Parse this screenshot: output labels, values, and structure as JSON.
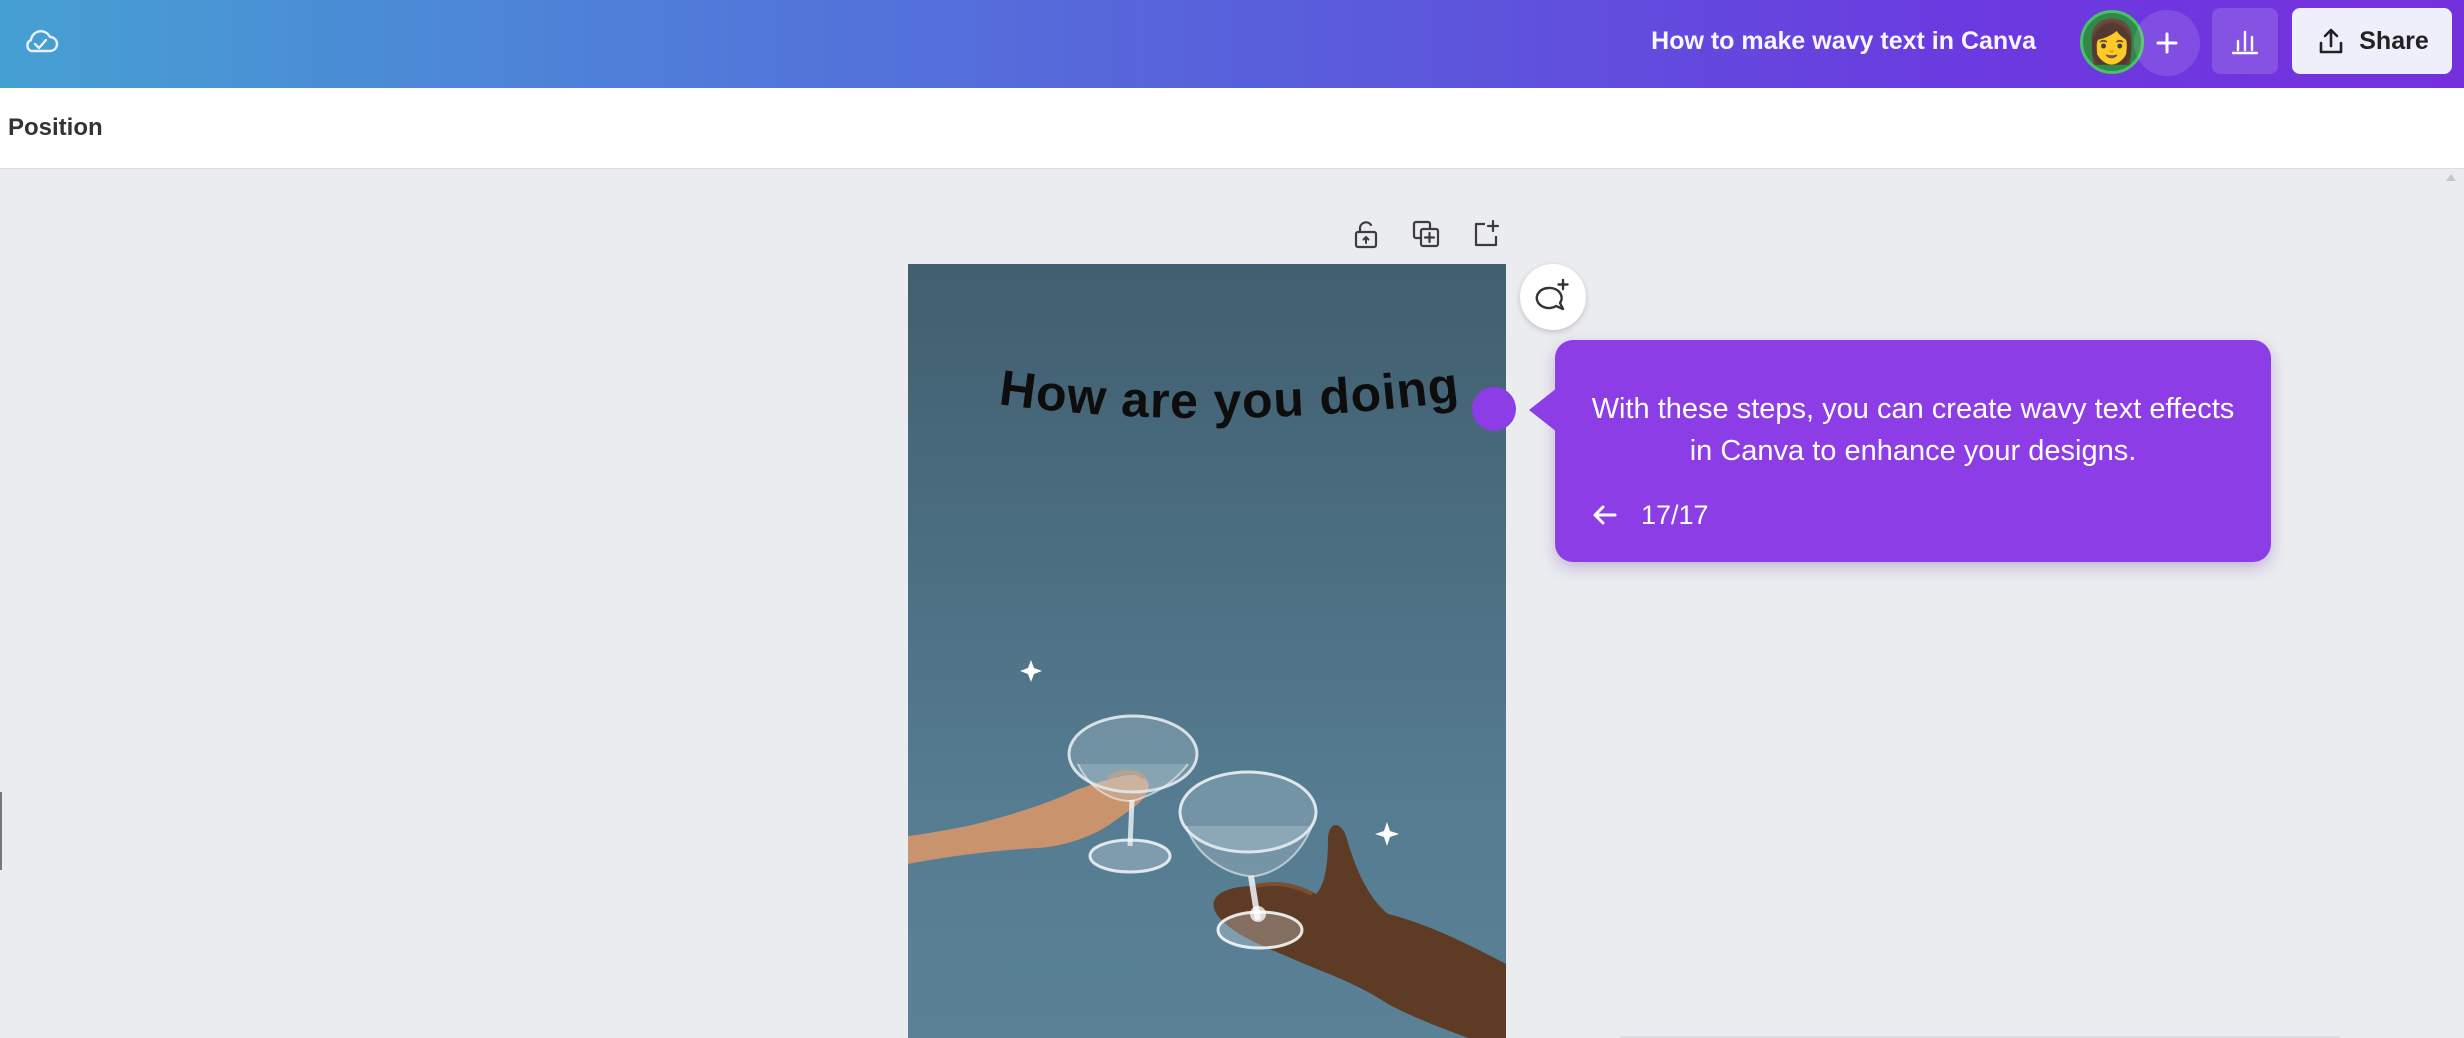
{
  "header": {
    "document_title": "How to make wavy text in Canva",
    "share_label": "Share",
    "cloud_icon": "cloud-check-icon",
    "plus_icon": "plus-icon",
    "stats_icon": "bar-chart-icon",
    "share_icon": "upload-icon",
    "avatar_emoji": "👩"
  },
  "toolbar": {
    "position_label": "Position"
  },
  "page_tools": {
    "lock_icon": "lock-icon",
    "duplicate_icon": "duplicate-page-icon",
    "add_page_icon": "add-page-icon"
  },
  "design": {
    "wavy_text": "How are you doing?",
    "background_color": "#4e7387"
  },
  "tour": {
    "message": "With these steps, you can create wavy text effects in Canva to enhance your designs.",
    "step_counter": "17/17",
    "back_icon": "arrow-left-icon",
    "accent_color": "#8d3de6"
  }
}
